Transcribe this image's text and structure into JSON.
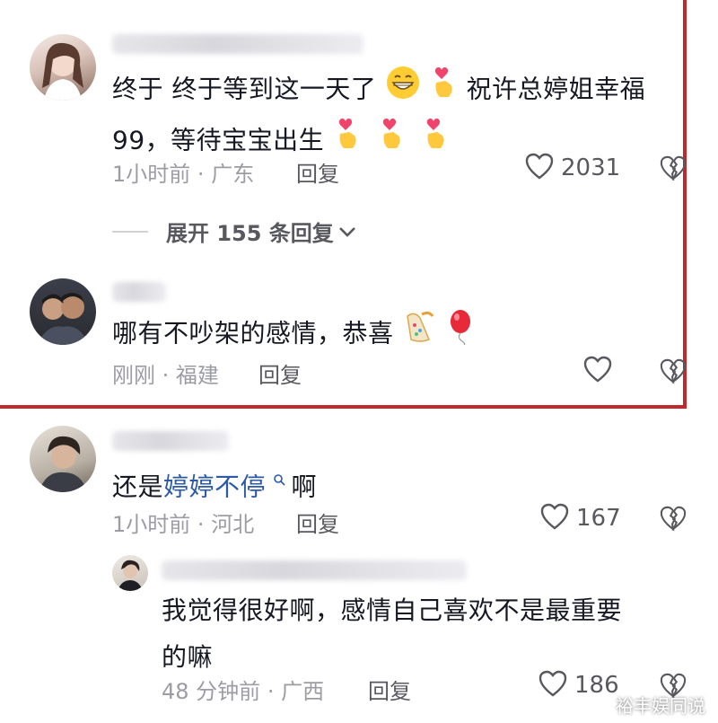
{
  "comments": [
    {
      "text_line1": "终于 终于等到这一天了",
      "text_line1b": "祝许总婷姐幸福",
      "text_line2": "99，等待宝宝出生",
      "time": "1小时前",
      "location": "广东",
      "reply_label": "回复",
      "likes": "2031"
    },
    {
      "text": "哪有不吵架的感情，恭喜",
      "time": "刚刚",
      "location": "福建",
      "reply_label": "回复"
    },
    {
      "text_prefix": "还是",
      "text_link": "婷婷不停",
      "text_suffix": "啊",
      "time": "1小时前",
      "location": "河北",
      "reply_label": "回复",
      "likes": "167"
    }
  ],
  "expand_replies_label": "展开 155 条回复",
  "reply": {
    "text_line1": "我觉得很好啊，感情自己喜欢不是最重要",
    "text_line2": "的嘛",
    "time": "48 分钟前",
    "location": "广西",
    "reply_label": "回复",
    "likes": "186"
  },
  "separator": "·",
  "watermark": "裕丰娱同说",
  "colors": {
    "highlight_border": "#c0282a",
    "link": "#2b5aa6"
  },
  "icons": [
    "heart-icon",
    "broken-heart-icon",
    "chevron-down-icon",
    "search-icon",
    "grin-emoji",
    "finger-heart-emoji",
    "party-popper-emoji",
    "balloon-emoji"
  ]
}
